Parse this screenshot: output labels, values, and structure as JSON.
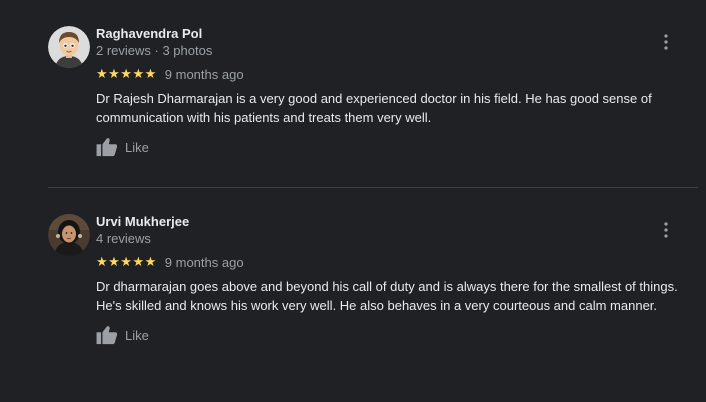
{
  "reviews": [
    {
      "name": "Raghavendra Pol",
      "meta": "2 reviews · 3 photos",
      "stars": "★★★★★",
      "rating": 5,
      "time": "9 months ago",
      "text": "Dr Rajesh Dharmarajan is a very good and experienced doctor in his field. He has good sense of communication with his patients and treats them very well.",
      "like_label": "Like",
      "avatar_icon": "cartoon-avatar-icon",
      "more_icon": "more-vert-icon"
    },
    {
      "name": "Urvi Mukherjee",
      "meta": "4 reviews",
      "stars": "★★★★★",
      "rating": 5,
      "time": "9 months ago",
      "text": "Dr dharmarajan goes above and beyond his call of duty and is always there for the smallest of things. He's skilled and knows his work very well. He also behaves in a very courteous and calm manner.",
      "like_label": "Like",
      "avatar_icon": "profile-photo-icon",
      "more_icon": "more-vert-icon"
    }
  ],
  "colors": {
    "background": "#202124",
    "star": "#fdd663",
    "primary_text": "#e8eaed",
    "secondary_text": "#9aa0a6",
    "divider": "#3c4043"
  }
}
